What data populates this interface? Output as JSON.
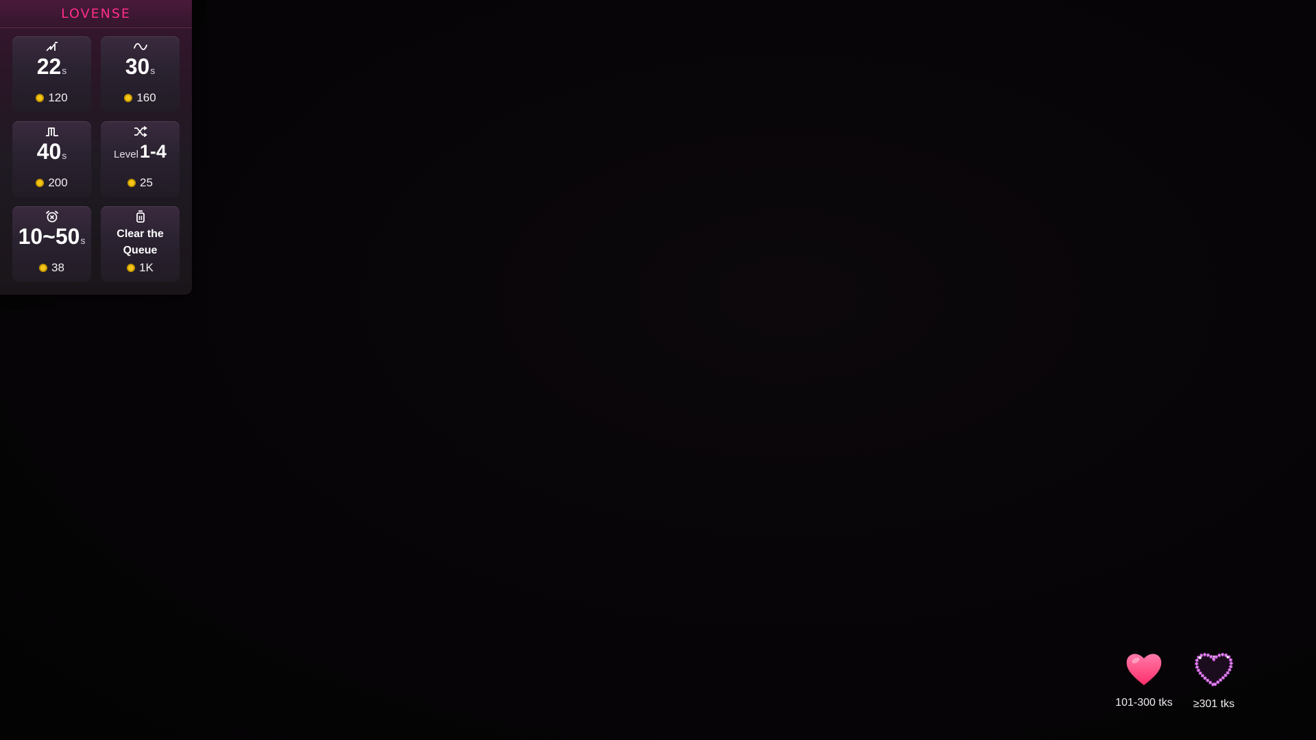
{
  "panel": {
    "logo": "LOVENSE",
    "tiles": [
      {
        "icon": "step-wave-icon",
        "value": "22",
        "unit": "s",
        "price": "120"
      },
      {
        "icon": "sine-wave-icon",
        "value": "30",
        "unit": "s",
        "price": "160"
      },
      {
        "icon": "pulse-wave-icon",
        "value": "40",
        "unit": "s",
        "price": "200"
      },
      {
        "icon": "shuffle-icon",
        "prefix": "Level",
        "value": "1-4",
        "price": "25"
      },
      {
        "icon": "alarm-clock-icon",
        "value": "10~50",
        "unit": "s",
        "price": "38"
      },
      {
        "icon": "trash-icon",
        "text_line1": "Clear the",
        "text_line2": "Queue",
        "price": "1K"
      }
    ]
  },
  "tips": [
    {
      "icon": "pink-heart-icon",
      "label": "101-300 tks"
    },
    {
      "icon": "sparkle-heart-icon",
      "label": "≥301 tks"
    }
  ],
  "colors": {
    "brand": "#ff2d8a",
    "coin": "#f5c518",
    "background": "#050305"
  }
}
